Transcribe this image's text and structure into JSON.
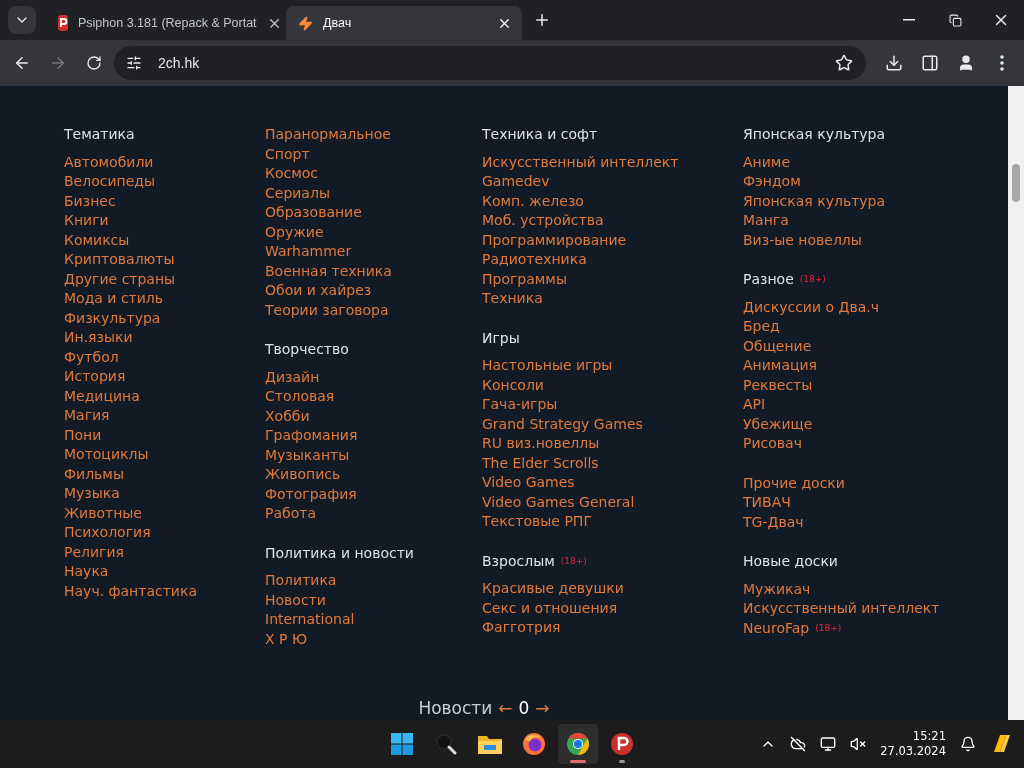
{
  "tabs": [
    {
      "title": "Psiphon 3.181 (Repack & Portat",
      "kind": "psiphon",
      "selected": false
    },
    {
      "title": "Двач",
      "kind": "bolt",
      "selected": true
    }
  ],
  "address": {
    "url": "2ch.hk"
  },
  "columns": [
    {
      "groups": [
        {
          "title": "Тематика",
          "links": [
            "Автомобили",
            "Велосипеды",
            "Бизнес",
            "Книги",
            "Комиксы",
            "Криптовалюты",
            "Другие страны",
            "Мода и стиль",
            "Физкультура",
            "Ин.языки",
            "Футбол",
            "История",
            "Медицина",
            "Магия",
            "Пони",
            "Мотоциклы",
            "Фильмы",
            "Музыка",
            "Животные",
            "Психология",
            "Религия",
            "Наука",
            "Науч. фантастика"
          ]
        }
      ]
    },
    {
      "groups": [
        {
          "links": [
            "Паранормальное",
            "Спорт",
            "Космос",
            "Сериалы",
            "Образование",
            "Оружие",
            "Warhammer",
            "Военная техника",
            "Обои и хайрез",
            "Теории заговора"
          ]
        },
        {
          "title": "Творчество",
          "links": [
            "Дизайн",
            "Столовая",
            "Хобби",
            "Графомания",
            "Музыканты",
            "Живопись",
            "Фотография",
            "Работа"
          ]
        },
        {
          "title": "Политика и новости",
          "links": [
            "Политика",
            "Новости",
            "International",
            "Х Р Ю"
          ]
        }
      ]
    },
    {
      "groups": [
        {
          "title": "Техника и софт",
          "links": [
            "Искусственный интеллект",
            "Gamedev",
            "Комп. железо",
            "Моб. устройства",
            "Программирование",
            "Радиотехника",
            "Программы",
            "Техника"
          ]
        },
        {
          "title": "Игры",
          "links": [
            "Настольные игры",
            "Консоли",
            "Гача-игры",
            "Grand Strategy Games",
            "RU виз.новеллы",
            "The Elder Scrolls",
            "Video Games",
            "Video Games General",
            "Текстовые РПГ"
          ]
        },
        {
          "title": "Взрослым",
          "badge": "(18+)",
          "links": [
            "Красивые девушки",
            "Секс и отношения",
            "Фагготрия"
          ]
        }
      ]
    },
    {
      "groups": [
        {
          "title": "Японская культура",
          "links": [
            "Аниме",
            "Фэндом",
            "Японская культура",
            "Манга",
            "Виз-ые новеллы"
          ]
        },
        {
          "title": "Разное",
          "badge": "(18+)",
          "links": [
            "Дискуссии о Два.ч",
            "Бред",
            "Общение",
            "Анимация",
            "Реквесты",
            "API",
            "Убежище",
            "Рисовач"
          ]
        },
        {
          "links": [
            "Прочие доски",
            "ТИВАЧ",
            "TG-Двач"
          ]
        },
        {
          "title": "Новые доски",
          "links": [
            "Мужикач",
            "Искусственный интеллект",
            {
              "text": "NeuroFap",
              "badge": "(18+)"
            }
          ]
        }
      ]
    }
  ],
  "footer": {
    "label": "Новости",
    "prev": "←",
    "count": "0",
    "next": "→"
  },
  "taskbar": {
    "apps": [
      {
        "kind": "windows",
        "active": false
      },
      {
        "kind": "search",
        "active": false
      },
      {
        "kind": "folder",
        "active": false
      },
      {
        "kind": "firefox",
        "active": false
      },
      {
        "kind": "chrome",
        "active": true
      },
      {
        "kind": "psiphon",
        "active": false
      }
    ],
    "time": "15:21",
    "date": "27.03.2024"
  }
}
